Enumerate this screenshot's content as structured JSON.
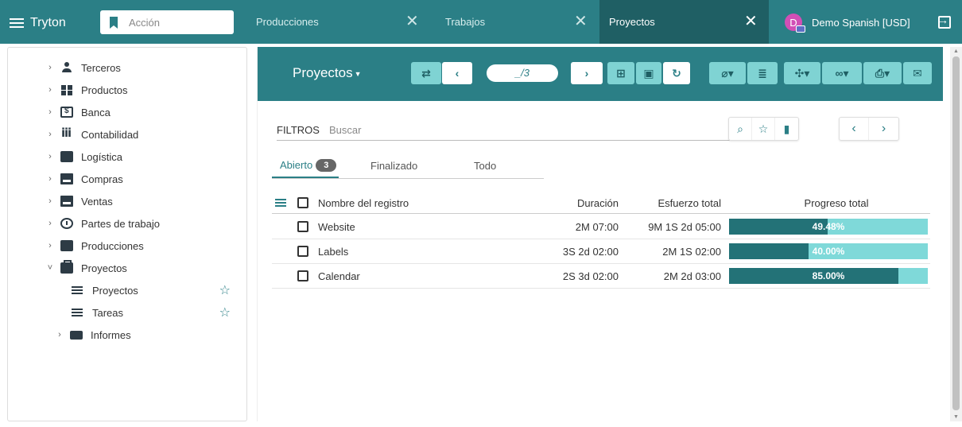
{
  "app": {
    "name": "Tryton"
  },
  "search": {
    "placeholder": "Acción"
  },
  "tabs": [
    {
      "label": "Producciones",
      "close": "✕"
    },
    {
      "label": "Trabajos",
      "close": "✕"
    },
    {
      "label": "Proyectos",
      "close": "✕"
    }
  ],
  "user": {
    "initial": "D",
    "name": "Demo Spanish [USD]"
  },
  "sidebar": {
    "items": [
      {
        "label": "Terceros",
        "icon": "person-icon"
      },
      {
        "label": "Productos",
        "icon": "blocks-icon"
      },
      {
        "label": "Banca",
        "icon": "bank-icon"
      },
      {
        "label": "Contabilidad",
        "icon": "columns-icon"
      },
      {
        "label": "Logística",
        "icon": "truck-icon"
      },
      {
        "label": "Compras",
        "icon": "cart-icon"
      },
      {
        "label": "Ventas",
        "icon": "store-icon"
      },
      {
        "label": "Partes de trabajo",
        "icon": "timer-icon"
      },
      {
        "label": "Producciones",
        "icon": "wrench-icon"
      },
      {
        "label": "Proyectos",
        "icon": "briefcase-icon"
      }
    ],
    "sub": [
      {
        "label": "Proyectos",
        "icon": "list-icon"
      },
      {
        "label": "Tareas",
        "icon": "list-icon"
      },
      {
        "label": "Informes",
        "icon": "folder-icon"
      }
    ]
  },
  "form": {
    "title": "Proyectos",
    "pager": "_/3"
  },
  "filter": {
    "label": "FILTROS",
    "placeholder": "Buscar"
  },
  "filter_tabs": [
    {
      "label": "Abierto",
      "count": "3"
    },
    {
      "label": "Finalizado"
    },
    {
      "label": "Todo"
    }
  ],
  "table": {
    "columns": [
      "Nombre del registro",
      "Duración",
      "Esfuerzo total",
      "Progreso total"
    ],
    "rows": [
      {
        "name": "Website",
        "duration": "2M 07:00",
        "effort": "9M 1S 2d 05:00",
        "progress": "49.48%",
        "progress_value": 0.4948
      },
      {
        "name": "Labels",
        "duration": "3S 2d 02:00",
        "effort": "2M 1S 02:00",
        "progress": "40.00%",
        "progress_value": 0.4
      },
      {
        "name": "Calendar",
        "duration": "2S 3d 02:00",
        "effort": "2M 2d 03:00",
        "progress": "85.00%",
        "progress_value": 0.85
      }
    ]
  },
  "colors": {
    "primary": "#2b7f86",
    "dark": "#1f5f64",
    "progress_fill": "#237277",
    "progress_bg": "#7fd9d9"
  }
}
